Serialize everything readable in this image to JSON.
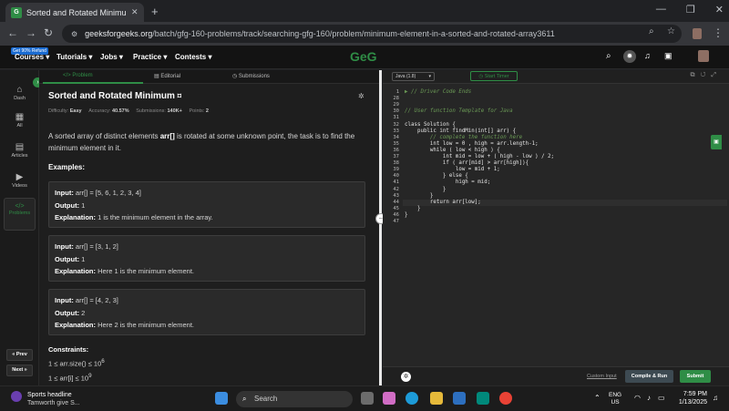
{
  "browser": {
    "tab_title": "Sorted and Rotated Minimum | Pr",
    "url_host": "geeksforgeeks.org",
    "url_path": "/batch/gfg-160-problems/track/searching-gfg-160/problem/minimum-element-in-a-sorted-and-rotated-array3611"
  },
  "site": {
    "refund_badge": "Get 90% Refund",
    "logo": "GeG",
    "menu": [
      "Courses",
      "Tutorials",
      "Jobs",
      "Practice",
      "Contests"
    ]
  },
  "sidebar": {
    "items": [
      {
        "label": "Dash",
        "icon": "⌂"
      },
      {
        "label": "All",
        "icon": "▦"
      },
      {
        "label": "Articles",
        "icon": "▤"
      },
      {
        "label": "Videos",
        "icon": "▶"
      },
      {
        "label": "Problems",
        "icon": "</>"
      }
    ],
    "prev": "« Prev",
    "next": "Next »"
  },
  "problem": {
    "tabs": [
      "</> Problem",
      "Editorial",
      "Submissions"
    ],
    "title": "Sorted and Rotated Minimum",
    "meta": {
      "difficulty_label": "Difficulty:",
      "difficulty": "Easy",
      "accuracy_label": "Accuracy:",
      "accuracy": "40.57%",
      "submissions_label": "Submissions:",
      "submissions": "140K+",
      "points_label": "Points:",
      "points": "2"
    },
    "desc_part1": "A sorted array of distinct elements ",
    "desc_bold": "arr[]",
    "desc_part2": " is rotated at some unknown point, the task is to find the minimum element in it.",
    "examples_label": "Examples:",
    "examples": [
      {
        "input": "arr[] = [5, 6, 1, 2, 3, 4]",
        "output": "1",
        "explanation": "1 is the minimum element in the array."
      },
      {
        "input": "arr[] = [3, 1, 2]",
        "output": "1",
        "explanation": "Here 1 is the minimum element."
      },
      {
        "input": "arr[] = [4, 2, 3]",
        "output": "2",
        "explanation": "Here 2 is the minimum element."
      }
    ],
    "input_label": "Input:",
    "output_label": "Output:",
    "explanation_label": "Explanation:",
    "constraints_label": "Constraints:",
    "constraint1": "1 ≤ arr.size() ≤ 10",
    "constraint1_exp": "6",
    "constraint2": "1 ≤ arr[i] ≤ 10",
    "constraint2_exp": "9"
  },
  "editor": {
    "language": "Java (1.8)",
    "timer_label": "Start Timer",
    "line_numbers": [
      "1",
      "28",
      "29",
      "30",
      "31",
      "32",
      "33",
      "34",
      "35",
      "36",
      "37",
      "38",
      "39",
      "40",
      "41",
      "42",
      "43",
      "44",
      "45",
      "46",
      "47"
    ],
    "lines": [
      {
        "text": "▶ // Driver Code Ends",
        "comment": true
      },
      {
        "text": "",
        "comment": false
      },
      {
        "text": "",
        "comment": false
      },
      {
        "text": "// User function Template for Java",
        "comment": true
      },
      {
        "text": "",
        "comment": false
      },
      {
        "text": "class Solution {",
        "comment": false
      },
      {
        "text": "    public int findMin(int[] arr) {",
        "comment": false
      },
      {
        "text": "        // complete the function here",
        "comment": true
      },
      {
        "text": "        int low = 0 , high = arr.length-1;",
        "comment": false
      },
      {
        "text": "        while ( low < high ) {",
        "comment": false
      },
      {
        "text": "            int mid = low + ( high - low ) / 2;",
        "comment": false
      },
      {
        "text": "            if ( arr[mid] > arr[high]){",
        "comment": false
      },
      {
        "text": "                low = mid + 1;",
        "comment": false
      },
      {
        "text": "            } else {",
        "comment": false
      },
      {
        "text": "                high = mid;",
        "comment": false
      },
      {
        "text": "            }",
        "comment": false
      },
      {
        "text": "        }",
        "comment": false
      },
      {
        "text": "        return arr[low];",
        "comment": false
      },
      {
        "text": "    }",
        "comment": false
      },
      {
        "text": "}",
        "comment": false
      },
      {
        "text": "",
        "comment": false
      }
    ],
    "custom_input": "Custom Input",
    "compile_run": "Compile & Run",
    "submit": "Submit"
  },
  "taskbar": {
    "news_title": "Sports headline",
    "news_sub": "Tamworth give S...",
    "search_placeholder": "Search",
    "lang_top": "ENG",
    "lang_bottom": "US",
    "time": "7:59 PM",
    "date": "1/13/2025"
  },
  "colors": {
    "accent": "#2f8d46",
    "panel": "#1e1e1e",
    "example_box": "#2a2a2a"
  }
}
